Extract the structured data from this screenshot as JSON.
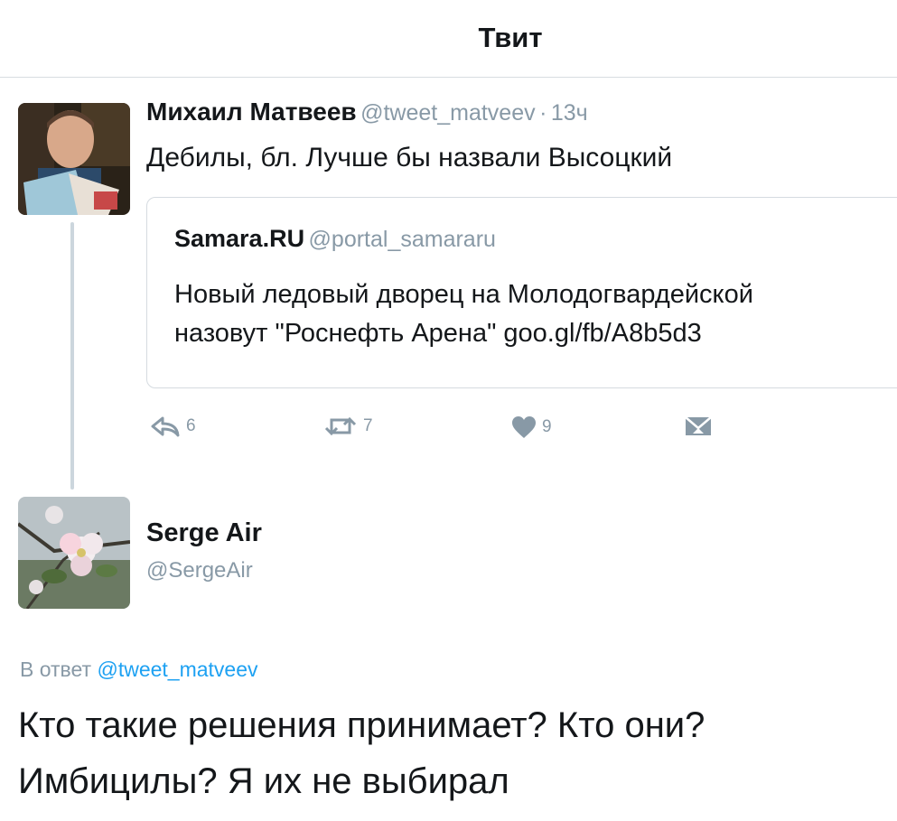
{
  "header": {
    "title": "Твит"
  },
  "tweet": {
    "author_name": "Михаил Матвеев",
    "author_handle": "@tweet_matveev",
    "separator": "·",
    "time": "13ч",
    "text": "Дебилы, бл. Лучше бы назвали Высоцкий",
    "avatar_icon": "person-reading-avatar",
    "quote": {
      "author_name": "Samara.RU",
      "author_handle": "@portal_samararu",
      "text_line1": "Новый ледовый дворец на Молодогвардейской",
      "text_line2": "назовут \"Роснефть Арена\" goo.gl/fb/A8b5d3"
    },
    "actions": {
      "reply_count": "6",
      "retweet_count": "7",
      "like_count": "9",
      "reply_icon": "reply-icon",
      "retweet_icon": "retweet-icon",
      "like_icon": "heart-icon",
      "dm_icon": "direct-message-icon"
    }
  },
  "reply": {
    "author_name": "Serge Air",
    "author_handle": "@SergeAir",
    "avatar_icon": "apple-blossom-avatar",
    "in_reply_prefix": "В ответ",
    "in_reply_to": "@tweet_matveev",
    "text_line1": "Кто такие решения принимает? Кто они?",
    "text_line2": "Имбицилы? Я их не выбирал"
  },
  "colors": {
    "link": "#1da1f2",
    "secondary_text": "#8899a6",
    "primary_text": "#14171a",
    "border": "#d5dbe0"
  }
}
